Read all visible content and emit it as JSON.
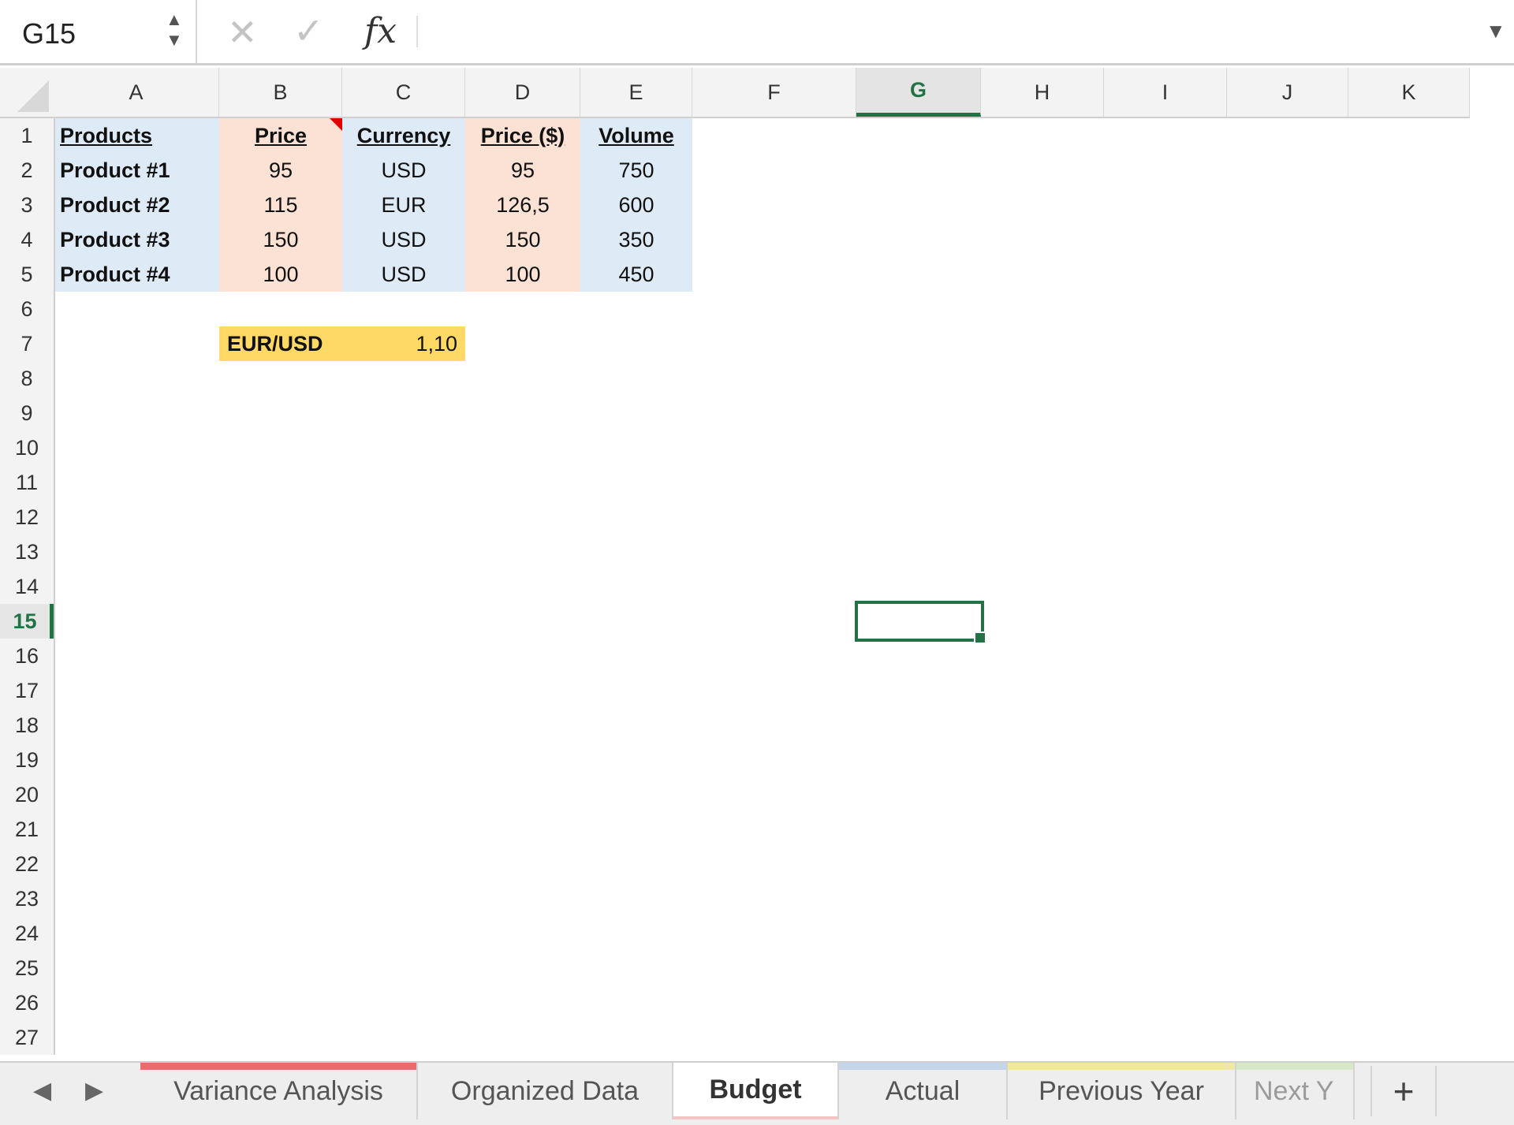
{
  "formula_bar": {
    "name_box": "G15",
    "formula": "",
    "cancel_icon": "✕",
    "enter_icon": "✓",
    "fx_label": "fx"
  },
  "columns": [
    "A",
    "B",
    "C",
    "D",
    "E",
    "F",
    "G",
    "H",
    "I",
    "J",
    "K"
  ],
  "rows": [
    "1",
    "2",
    "3",
    "4",
    "5",
    "6",
    "7",
    "8",
    "9",
    "10",
    "11",
    "12",
    "13",
    "14",
    "15",
    "16",
    "17",
    "18",
    "19",
    "20",
    "21",
    "22",
    "23",
    "24",
    "25",
    "26",
    "27"
  ],
  "active_cell": {
    "column": "G",
    "row": "15"
  },
  "table": {
    "headers": [
      "Products",
      "Price",
      "Currency",
      "Price ($)",
      "Volume"
    ],
    "rows": [
      [
        "Product #1",
        "95",
        "USD",
        "95",
        "750"
      ],
      [
        "Product #2",
        "115",
        "EUR",
        "126,5",
        "600"
      ],
      [
        "Product #3",
        "150",
        "USD",
        "150",
        "350"
      ],
      [
        "Product #4",
        "100",
        "USD",
        "100",
        "450"
      ]
    ]
  },
  "fx_rate": {
    "label": "EUR/USD",
    "value": "1,10"
  },
  "colors": {
    "accent": "#217346",
    "blue_fill": "#deebf7",
    "peach_fill": "#fbe2d5",
    "gold_fill": "#ffd966",
    "comment_flag": "#e00000"
  },
  "tabs": [
    {
      "label": "Variance Analysis",
      "color": "#e96b6b",
      "active": false
    },
    {
      "label": "Organized Data",
      "color": "",
      "active": false
    },
    {
      "label": "Budget",
      "color": "",
      "active": true
    },
    {
      "label": "Actual",
      "color": "#c5d6ea",
      "active": false
    },
    {
      "label": "Previous Year",
      "color": "#f1e7a4",
      "active": false
    },
    {
      "label": "Next Y",
      "color": "#d6e8c8",
      "active": false
    }
  ],
  "tab_nav": {
    "prev_icon": "◀",
    "next_icon": "▶",
    "add_icon": "+"
  }
}
